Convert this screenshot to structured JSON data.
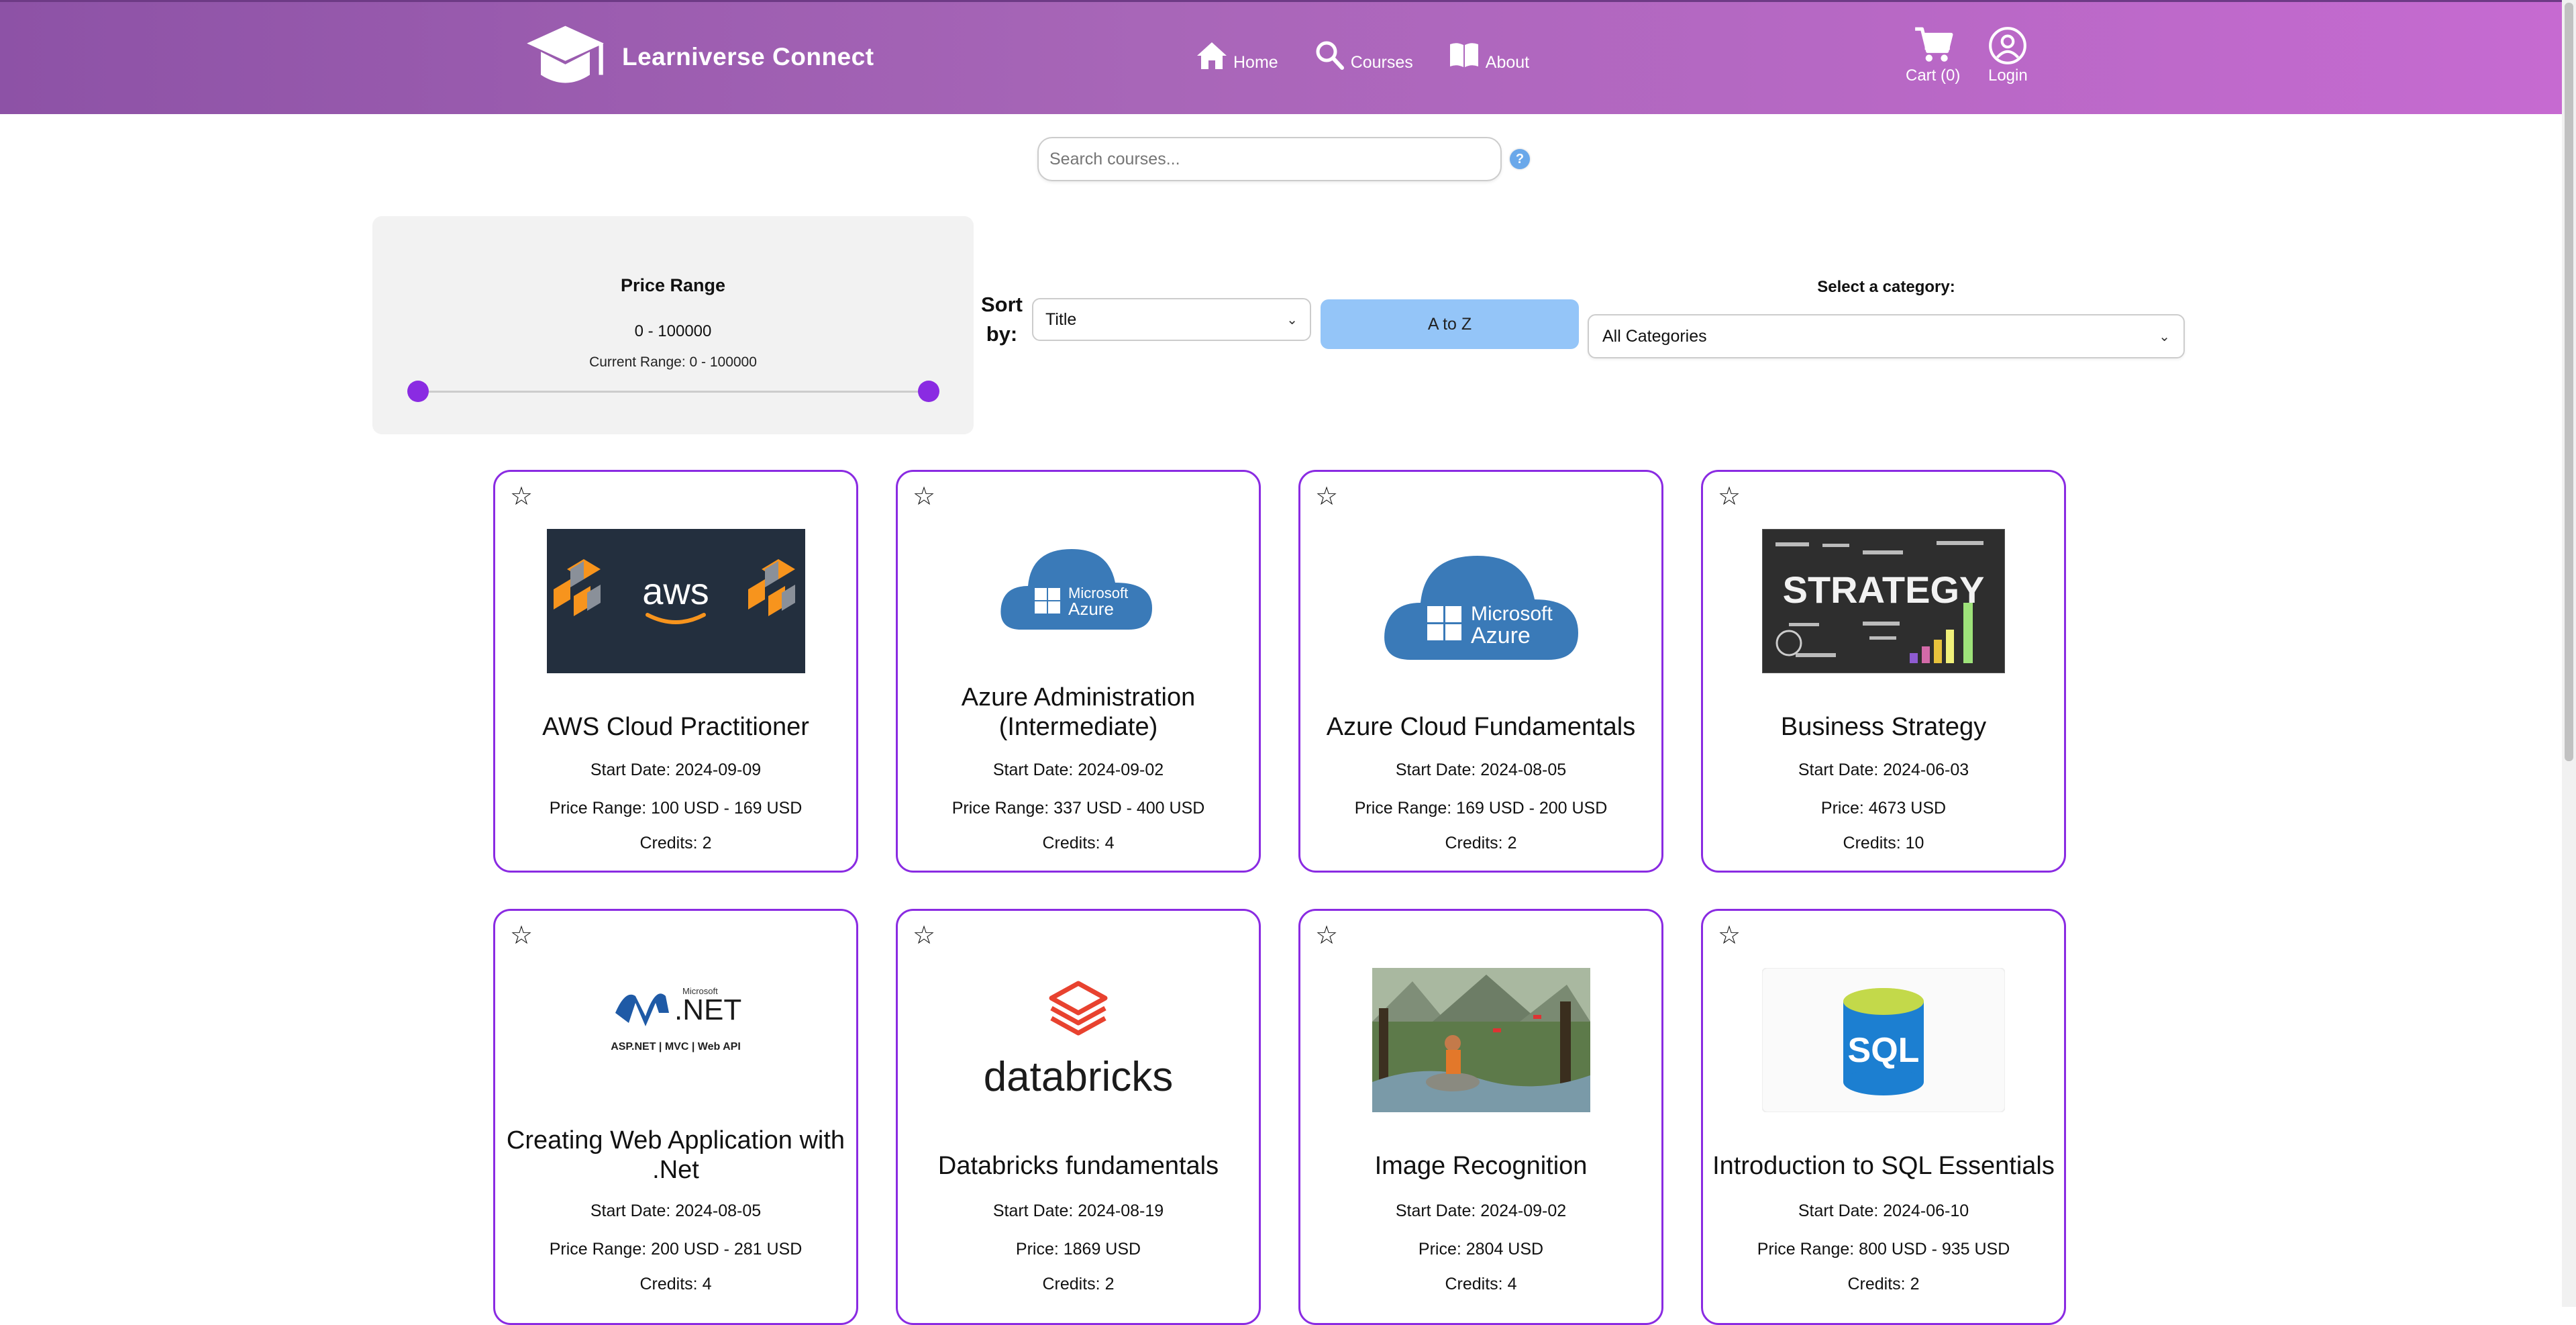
{
  "header": {
    "brand": "Learniverse Connect",
    "nav": [
      {
        "label": "Home",
        "icon": "home-icon"
      },
      {
        "label": "Courses",
        "icon": "search-icon"
      },
      {
        "label": "About",
        "icon": "book-icon"
      }
    ],
    "cart_label": "Cart (0)",
    "login_label": "Login",
    "gradient_colors": [
      "#8d52a6",
      "#c66ad1"
    ]
  },
  "search": {
    "placeholder": "Search courses...",
    "help": "?"
  },
  "filters": {
    "price_title": "Price Range",
    "price_range": "0 - 100000",
    "current_range": "Current Range: 0 - 100000",
    "sort_label": "Sort by:",
    "sort_value": "Title",
    "order_button": "A to Z",
    "category_label": "Select a category:",
    "category_value": "All Categories"
  },
  "accent_color": "#8a2be2",
  "courses": [
    {
      "title": "AWS Cloud Practitioner",
      "start": "Start Date: 2024-09-09",
      "price": "Price Range: 100 USD - 169 USD",
      "credits": "Credits: 2",
      "image": "aws"
    },
    {
      "title": "Azure Administration (Intermediate)",
      "start": "Start Date: 2024-09-02",
      "price": "Price Range: 337 USD - 400 USD",
      "credits": "Credits: 4",
      "image": "azure-small"
    },
    {
      "title": "Azure Cloud Fundamentals",
      "start": "Start Date: 2024-08-05",
      "price": "Price Range: 169 USD - 200 USD",
      "credits": "Credits: 2",
      "image": "azure"
    },
    {
      "title": "Business Strategy",
      "start": "Start Date: 2024-06-03",
      "price": "Price: 4673 USD",
      "credits": "Credits: 10",
      "image": "strategy"
    },
    {
      "title": "Creating Web Application with .Net",
      "start": "Start Date: 2024-08-05",
      "price": "Price Range: 200 USD - 281 USD",
      "credits": "Credits: 4",
      "image": "dotnet"
    },
    {
      "title": "Databricks fundamentals",
      "start": "Start Date: 2024-08-19",
      "price": "Price: 1869 USD",
      "credits": "Credits: 2",
      "image": "databricks"
    },
    {
      "title": "Image Recognition",
      "start": "Start Date: 2024-09-02",
      "price": "Price: 2804 USD",
      "credits": "Credits: 4",
      "image": "photo"
    },
    {
      "title": "Introduction to SQL Essentials",
      "start": "Start Date: 2024-06-10",
      "price": "Price Range: 800 USD - 935 USD",
      "credits": "Credits: 2",
      "image": "sql"
    }
  ],
  "logo_text": {
    "aws": "aws",
    "microsoft": "Microsoft",
    "azure": "Azure",
    "strategy": "STRATEGY",
    "net": ".NET",
    "net_sub": "ASP.NET | MVC | Web API",
    "databricks": "databricks",
    "sql": "SQL"
  },
  "star_glyph": "☆"
}
